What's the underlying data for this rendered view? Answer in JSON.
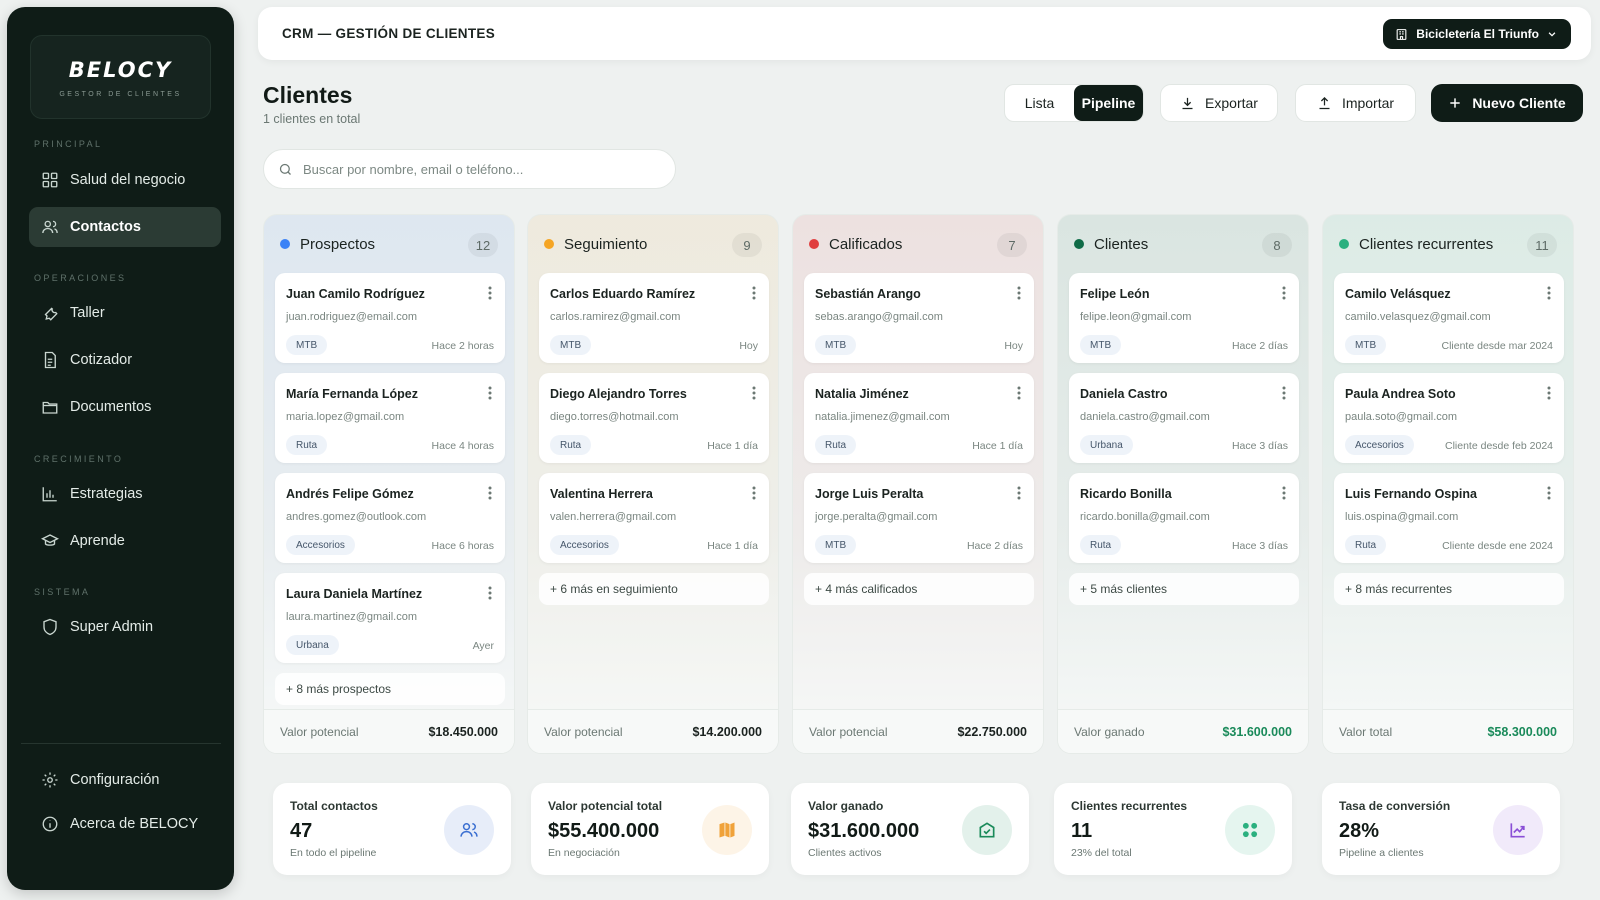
{
  "sidebar": {
    "logo": "BELOCY",
    "logo_sub": "GESTOR DE CLIENTES",
    "sections": {
      "principal": "PRINCIPAL",
      "operaciones": "OPERACIONES",
      "crecimiento": "CRECIMIENTO",
      "sistema": "SISTEMA"
    },
    "items": {
      "salud": "Salud del negocio",
      "contactos": "Contactos",
      "taller": "Taller",
      "cotizador": "Cotizador",
      "documentos": "Documentos",
      "estrategias": "Estrategias",
      "aprende": "Aprende",
      "superadmin": "Super Admin",
      "config": "Configuración",
      "acerca": "Acerca de BELOCY"
    }
  },
  "topbar": {
    "breadcrumb": "CRM — GESTIÓN DE CLIENTES",
    "business": "Bicicletería El Triunfo"
  },
  "header": {
    "title": "Clientes",
    "subtitle": "1 clientes en total",
    "view_lista": "Lista",
    "view_pipeline": "Pipeline",
    "export": "Exportar",
    "import": "Importar",
    "new_client": "Nuevo Cliente"
  },
  "search": {
    "placeholder": "Buscar por nombre, email o teléfono..."
  },
  "columns": [
    {
      "title": "Prospectos",
      "count": "12",
      "color": "#3b82f6",
      "cards": [
        {
          "name": "Juan Camilo Rodríguez",
          "email": "juan.rodriguez@email.com",
          "tag": "MTB",
          "time": "Hace 2 horas"
        },
        {
          "name": "María Fernanda López",
          "email": "maria.lopez@gmail.com",
          "tag": "Ruta",
          "time": "Hace 4 horas"
        },
        {
          "name": "Andrés Felipe Gómez",
          "email": "andres.gomez@outlook.com",
          "tag": "Accesorios",
          "time": "Hace 6 horas"
        },
        {
          "name": "Laura Daniela Martínez",
          "email": "laura.martinez@gmail.com",
          "tag": "Urbana",
          "time": "Ayer"
        }
      ],
      "more": "+ 8 más prospectos",
      "footer_label": "Valor potencial",
      "footer_value": "$18.450.000"
    },
    {
      "title": "Seguimiento",
      "count": "9",
      "color": "#f5a524",
      "cards": [
        {
          "name": "Carlos Eduardo Ramírez",
          "email": "carlos.ramirez@gmail.com",
          "tag": "MTB",
          "time": "Hoy"
        },
        {
          "name": "Diego Alejandro Torres",
          "email": "diego.torres@hotmail.com",
          "tag": "Ruta",
          "time": "Hace 1 día"
        },
        {
          "name": "Valentina Herrera",
          "email": "valen.herrera@gmail.com",
          "tag": "Accesorios",
          "time": "Hace 1 día"
        }
      ],
      "more": "+ 6 más en seguimiento",
      "footer_label": "Valor potencial",
      "footer_value": "$14.200.000"
    },
    {
      "title": "Calificados",
      "count": "7",
      "color": "#e03e3e",
      "cards": [
        {
          "name": "Sebastián Arango",
          "email": "sebas.arango@gmail.com",
          "tag": "MTB",
          "time": "Hoy"
        },
        {
          "name": "Natalia Jiménez",
          "email": "natalia.jimenez@gmail.com",
          "tag": "Ruta",
          "time": "Hace 1 día"
        },
        {
          "name": "Jorge Luis Peralta",
          "email": "jorge.peralta@gmail.com",
          "tag": "MTB",
          "time": "Hace 2 días"
        }
      ],
      "more": "+ 4 más calificados",
      "footer_label": "Valor potencial",
      "footer_value": "$22.750.000"
    },
    {
      "title": "Clientes",
      "count": "8",
      "color": "#0f6b47",
      "cards": [
        {
          "name": "Felipe León",
          "email": "felipe.leon@gmail.com",
          "tag": "MTB",
          "time": "Hace 2 días"
        },
        {
          "name": "Daniela Castro",
          "email": "daniela.castro@gmail.com",
          "tag": "Urbana",
          "time": "Hace 3 días"
        },
        {
          "name": "Ricardo Bonilla",
          "email": "ricardo.bonilla@gmail.com",
          "tag": "Ruta",
          "time": "Hace 3 días"
        }
      ],
      "more": "+ 5 más clientes",
      "footer_label": "Valor ganado",
      "footer_value": "$31.600.000"
    },
    {
      "title": "Clientes recurrentes",
      "count": "11",
      "color": "#2bb07f",
      "cards": [
        {
          "name": "Camilo Velásquez",
          "email": "camilo.velasquez@gmail.com",
          "tag": "MTB",
          "time": "Cliente desde mar 2024"
        },
        {
          "name": "Paula Andrea Soto",
          "email": "paula.soto@gmail.com",
          "tag": "Accesorios",
          "time": "Cliente desde feb 2024"
        },
        {
          "name": "Luis Fernando Ospina",
          "email": "luis.ospina@gmail.com",
          "tag": "Ruta",
          "time": "Cliente desde ene 2024"
        }
      ],
      "more": "+ 8 más recurrentes",
      "footer_label": "Valor total",
      "footer_value": "$58.300.000"
    }
  ],
  "stats": [
    {
      "label": "Total contactos",
      "value": "47",
      "note": "En todo el pipeline",
      "icon": "users-icon",
      "color": "#3b6fd1"
    },
    {
      "label": "Valor potencial total",
      "value": "$55.400.000",
      "note": "En negociación",
      "icon": "map-icon",
      "color": "#f0a23a"
    },
    {
      "label": "Valor ganado",
      "value": "$31.600.000",
      "note": "Clientes activos",
      "icon": "wallet-check-icon",
      "color": "#1a8a5a"
    },
    {
      "label": "Clientes recurrentes",
      "value": "11",
      "note": "23% del total",
      "icon": "recurring-icon",
      "color": "#2bb07f"
    },
    {
      "label": "Tasa de conversión",
      "value": "28%",
      "note": "Pipeline a clientes",
      "icon": "trend-up-icon",
      "color": "#8a4fd6"
    }
  ]
}
